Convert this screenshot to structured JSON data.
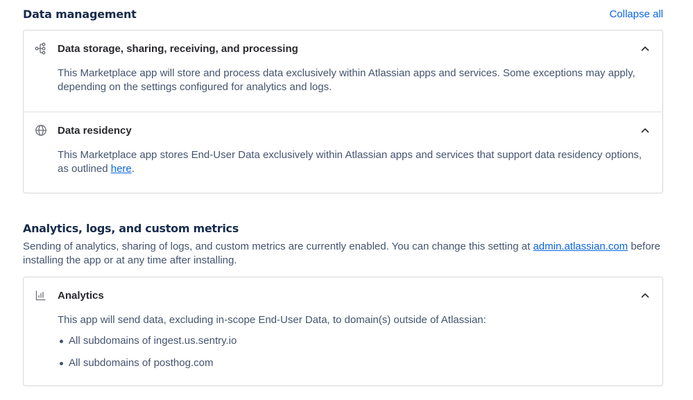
{
  "data_management": {
    "title": "Data management",
    "collapse_all": "Collapse all",
    "items": [
      {
        "icon": "data-flow-icon",
        "title": "Data storage, sharing, receiving, and processing",
        "body": "This Marketplace app will store and process data exclusively within Atlassian apps and services. Some exceptions may apply, depending on the settings configured for analytics and logs."
      },
      {
        "icon": "globe-icon",
        "title": "Data residency",
        "body_before": "This Marketplace app stores End-User Data exclusively within Atlassian apps and services that support data residency options, as outlined ",
        "link_text": "here",
        "body_after": "."
      }
    ]
  },
  "analytics": {
    "title": "Analytics, logs, and custom metrics",
    "desc_before": "Sending of analytics, sharing of logs, and custom metrics are currently enabled. You can change this setting at ",
    "desc_link": "admin.atlassian.com",
    "desc_after": " before installing the app or at any time after installing.",
    "card": {
      "icon": "bar-chart-icon",
      "title": "Analytics",
      "intro": "This app will send data, excluding in-scope End-User Data, to domain(s) outside of Atlassian:",
      "domains": [
        "All subdomains of ingest.us.sentry.io",
        "All subdomains of posthog.com"
      ]
    }
  }
}
